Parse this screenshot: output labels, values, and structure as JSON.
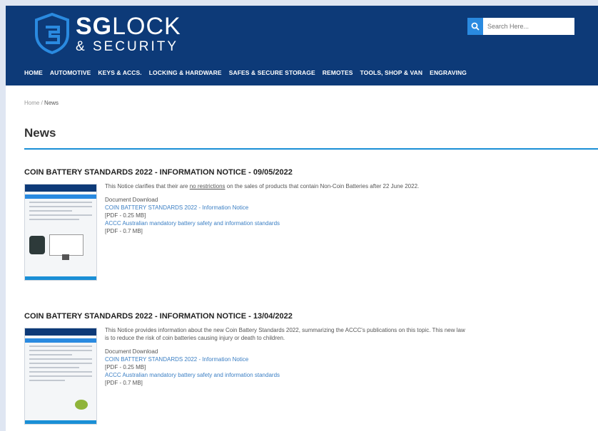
{
  "brand": {
    "line1_bold": "SG",
    "line1_rest": "LOCK",
    "line2": "& SECURITY"
  },
  "search": {
    "placeholder": "Search Here..."
  },
  "nav": [
    "HOME",
    "AUTOMOTIVE",
    "KEYS & ACCS.",
    "LOCKING & HARDWARE",
    "SAFES & SECURE STORAGE",
    "REMOTES",
    "TOOLS, SHOP & VAN",
    "ENGRAVING"
  ],
  "breadcrumb": {
    "home": "Home",
    "sep": "/",
    "current": "News"
  },
  "page_title": "News",
  "articles": [
    {
      "title": "COIN BATTERY STANDARDS 2022 - INFORMATION NOTICE - 09/05/2022",
      "intro_pre": "This Notice clarifies that their are ",
      "intro_u": "no restrictions",
      "intro_post": " on the sales of products that contain Non-Coin Batteries after 22 June 2022.",
      "download_label": "Document Download",
      "link1": "COIN BATTERY STANDARDS 2022 - Information Notice",
      "size1": "[PDF - 0.25 MB]",
      "link2": "ACCC Australian mandatory battery safety and information standards",
      "size2": "[PDF - 0.7 MB]"
    },
    {
      "title": "COIN BATTERY STANDARDS 2022 - INFORMATION NOTICE - 13/04/2022",
      "intro": "This Notice provides information about the new Coin Battery Standards 2022, summarizing the ACCC's publications on this topic. This new law is to reduce the risk of coin batteries causing injury or death to children.",
      "download_label": "Document Download",
      "link1": "COIN BATTERY STANDARDS 2022 - Information Notice",
      "size1": "[PDF - 0.25 MB]",
      "link2": "ACCC Australian mandatory battery safety and information standards",
      "size2": "[PDF - 0.7 MB]"
    }
  ]
}
